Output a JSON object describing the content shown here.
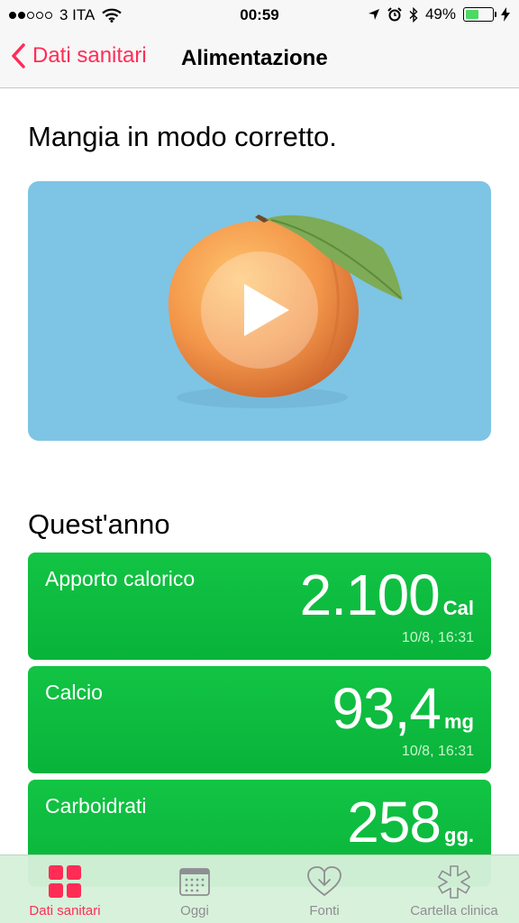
{
  "status_bar": {
    "signal_dots_on": 2,
    "carrier": "3 ITA",
    "time": "00:59",
    "battery_text": "49%",
    "battery_level": 0.49,
    "icons": [
      "wifi-icon",
      "location-arrow-icon",
      "alarm-icon",
      "bluetooth-icon",
      "battery-icon",
      "charging-bolt-icon"
    ]
  },
  "nav": {
    "back_label": "Dati sanitari",
    "title": "Alimentazione"
  },
  "intro": {
    "headline": "Mangia in modo corretto."
  },
  "video": {
    "icon": "play-icon",
    "background_color": "#7ec4e4"
  },
  "section": {
    "title": "Quest'anno"
  },
  "cards": [
    {
      "label": "Apporto calorico",
      "value": "2.100",
      "unit": "Cal",
      "timestamp": "10/8, 16:31"
    },
    {
      "label": "Calcio",
      "value": "93,4",
      "unit": "mg",
      "timestamp": "10/8, 16:31"
    },
    {
      "label": "Carboidrati",
      "value": "258",
      "unit": "gg.",
      "timestamp": ""
    }
  ],
  "tabs": [
    {
      "label": "Dati sanitari",
      "icon": "health-data-grid-icon",
      "active": true
    },
    {
      "label": "Oggi",
      "icon": "calendar-icon",
      "active": false
    },
    {
      "label": "Fonti",
      "icon": "heart-download-icon",
      "active": false
    },
    {
      "label": "Cartella clinica",
      "icon": "medical-asterisk-icon",
      "active": false
    }
  ],
  "colors": {
    "accent": "#ff2d55",
    "card_green": "#0bb83c",
    "tab_inactive": "#8e8e93"
  }
}
